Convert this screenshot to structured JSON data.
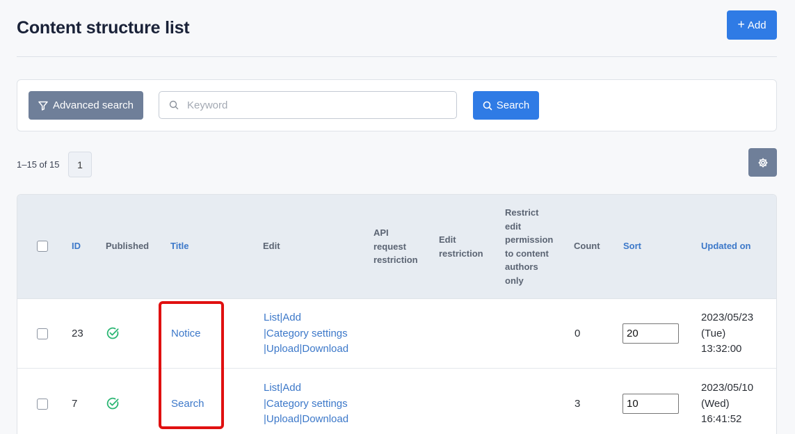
{
  "header": {
    "title": "Content structure list",
    "add_label": "Add"
  },
  "search": {
    "advanced_label": "Advanced search",
    "keyword_placeholder": "Keyword",
    "search_label": "Search"
  },
  "pagination": {
    "range_text": "1–15 of 15",
    "current_page": "1"
  },
  "table": {
    "columns": {
      "id": "ID",
      "published": "Published",
      "title": "Title",
      "edit": "Edit",
      "api_line1": "API",
      "api_line2": "request",
      "api_line3": "restriction",
      "edit_restr_line1": "Edit",
      "edit_restr_line2": "restriction",
      "restrict_line1": "Restrict",
      "restrict_line2": "edit",
      "restrict_line3": "permission",
      "restrict_line4": "to content",
      "restrict_line5": "authors",
      "restrict_line6": "only",
      "count": "Count",
      "sort": "Sort",
      "updated": "Updated on"
    },
    "edit_links": {
      "list": "List",
      "add": "Add",
      "category": "Category settings",
      "upload": "Upload",
      "download": "Download",
      "sep": "|"
    },
    "rows": [
      {
        "id": "23",
        "title": "Notice",
        "count": "0",
        "sort": "20",
        "updated_date": "2023/05/23",
        "updated_day": "(Tue)",
        "updated_time": "13:32:00"
      },
      {
        "id": "7",
        "title": "Search",
        "count": "3",
        "sort": "10",
        "updated_date": "2023/05/10",
        "updated_day": "(Wed)",
        "updated_time": "16:41:52"
      }
    ]
  },
  "colors": {
    "primary": "#2f7be5",
    "secondary": "#6f7f99",
    "link": "#3c78c9",
    "published_check": "#2bb673",
    "highlight": "#e01010"
  }
}
